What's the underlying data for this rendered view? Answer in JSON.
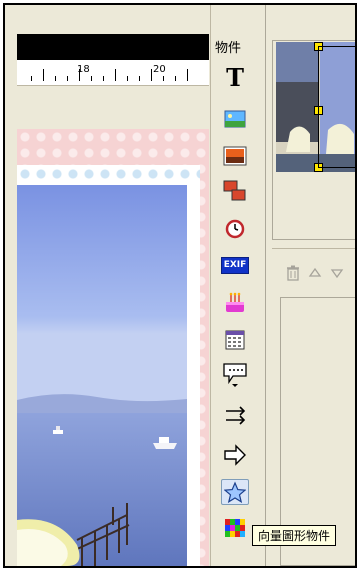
{
  "ruler": {
    "marks": [
      "18",
      "20"
    ]
  },
  "toolbar": {
    "title": "物件",
    "tools": [
      {
        "icon": "text-tool-icon",
        "glyph": "T"
      },
      {
        "icon": "image-icon"
      },
      {
        "icon": "photo-frame-icon"
      },
      {
        "icon": "multi-photo-icon"
      },
      {
        "icon": "clock-icon"
      },
      {
        "icon": "exif-icon",
        "text": "EXIF"
      },
      {
        "icon": "birthday-cake-icon"
      },
      {
        "icon": "calendar-icon"
      },
      {
        "icon": "speech-bubble-icon"
      },
      {
        "icon": "line-arrows-icon"
      },
      {
        "icon": "arrow-shape-icon"
      },
      {
        "icon": "star-shape-icon"
      },
      {
        "icon": "mosaic-icon"
      }
    ]
  },
  "right_panel": {
    "mini_toolbar": [
      "trash-icon",
      "up-arrow-icon",
      "down-arrow-icon"
    ]
  },
  "tooltip": {
    "text": "向量圖形物件"
  }
}
